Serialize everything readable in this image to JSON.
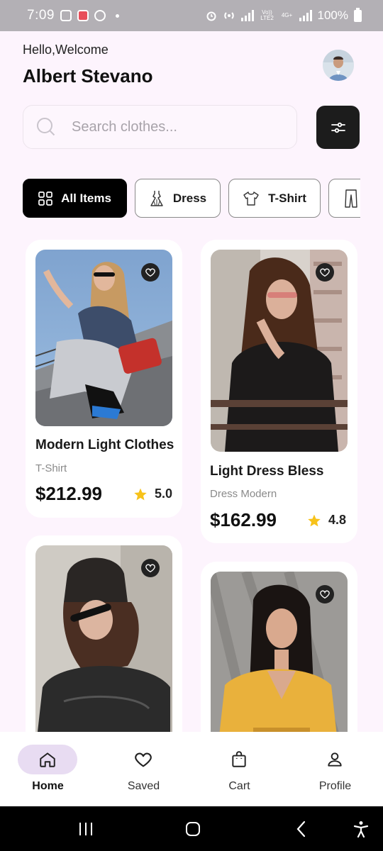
{
  "status_bar": {
    "time": "7:09",
    "network_label": "Vo)) LTE2",
    "network_4g": "4G+",
    "battery": "100%"
  },
  "header": {
    "greeting": "Hello,Welcome",
    "user_name": "Albert Stevano"
  },
  "search": {
    "placeholder": "Search clothes..."
  },
  "categories": [
    {
      "label": "All Items",
      "icon": "grid-icon",
      "active": true
    },
    {
      "label": "Dress",
      "icon": "dress-icon",
      "active": false
    },
    {
      "label": "T-Shirt",
      "icon": "tshirt-icon",
      "active": false
    },
    {
      "label": "",
      "icon": "pants-icon",
      "active": false
    }
  ],
  "products": [
    {
      "title": "Modern Light Clothes",
      "category": "T-Shirt",
      "price": "$212.99",
      "rating": "5.0"
    },
    {
      "title": "Light Dress Bless",
      "category": "Dress Modern",
      "price": "$162.99",
      "rating": "4.8"
    },
    {
      "title": "",
      "category": "",
      "price": "",
      "rating": ""
    },
    {
      "title": "",
      "category": "",
      "price": "",
      "rating": ""
    }
  ],
  "bottom_nav": [
    {
      "label": "Home",
      "icon": "home-icon",
      "active": true
    },
    {
      "label": "Saved",
      "icon": "heart-icon",
      "active": false
    },
    {
      "label": "Cart",
      "icon": "bag-icon",
      "active": false
    },
    {
      "label": "Profile",
      "icon": "user-icon",
      "active": false
    }
  ],
  "colors": {
    "background": "#fdf4fd",
    "accent_dark": "#1c1c1c",
    "nav_active": "#e8dcf2",
    "star": "#f7c21a"
  }
}
